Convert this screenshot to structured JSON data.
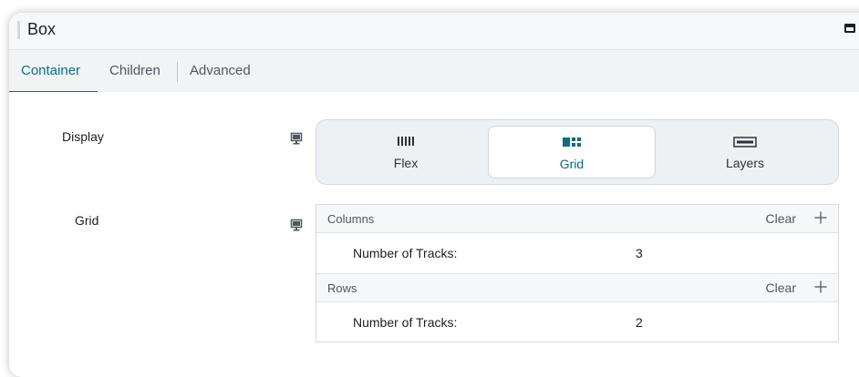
{
  "window": {
    "title": "Box",
    "maximize_icon": "window-maximize-icon"
  },
  "tabs": [
    {
      "label": "Container",
      "active": true
    },
    {
      "label": "Children",
      "active": false
    },
    {
      "label": "Advanced",
      "active": false
    }
  ],
  "accent_color": "#0e6d8a",
  "display": {
    "label": "Display",
    "device_icon": "desktop-icon",
    "options": [
      {
        "label": "Flex",
        "icon": "flex-columns-icon",
        "selected": false
      },
      {
        "label": "Grid",
        "icon": "grid-icon",
        "selected": true
      },
      {
        "label": "Layers",
        "icon": "layers-icon",
        "selected": false
      }
    ]
  },
  "grid": {
    "label": "Grid",
    "device_icon": "desktop-icon",
    "columns": {
      "title": "Columns",
      "clear_label": "Clear",
      "track_label": "Number of Tracks:",
      "track_value": "3"
    },
    "rows": {
      "title": "Rows",
      "clear_label": "Clear",
      "track_label": "Number of Tracks:",
      "track_value": "2"
    }
  }
}
